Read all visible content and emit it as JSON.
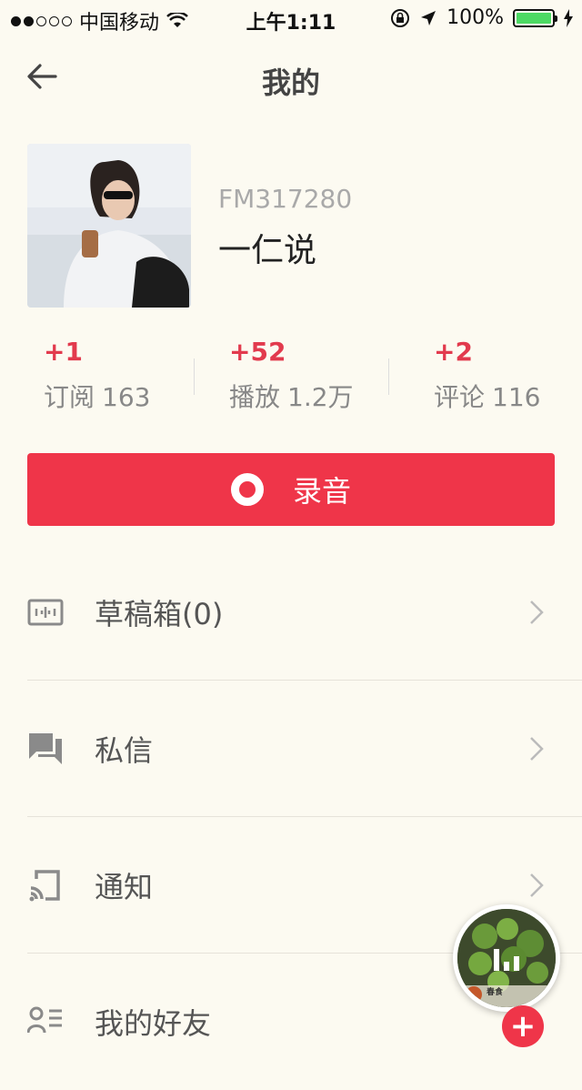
{
  "status_bar": {
    "carrier": "中国移动",
    "time": "上午1:11",
    "battery_percent": "100%"
  },
  "nav": {
    "title": "我的"
  },
  "profile": {
    "id": "FM317280",
    "name": "一仁说"
  },
  "stats": [
    {
      "delta": "+1",
      "label": "订阅",
      "value": "163"
    },
    {
      "delta": "+52",
      "label": "播放",
      "value": "1.2万"
    },
    {
      "delta": "+2",
      "label": "评论",
      "value": "116"
    }
  ],
  "record_button": {
    "label": "录音"
  },
  "menu": [
    {
      "label": "草稿箱(0)",
      "icon": "draft-box-icon"
    },
    {
      "label": "私信",
      "icon": "chat-bubbles-icon"
    },
    {
      "label": "通知",
      "icon": "cast-icon"
    },
    {
      "label": "我的好友",
      "icon": "friends-list-icon"
    }
  ],
  "mini_player": {
    "cover_caption": "春食"
  },
  "colors": {
    "accent": "#ef3549",
    "background": "#fcfaf1",
    "battery": "#4cd964"
  }
}
